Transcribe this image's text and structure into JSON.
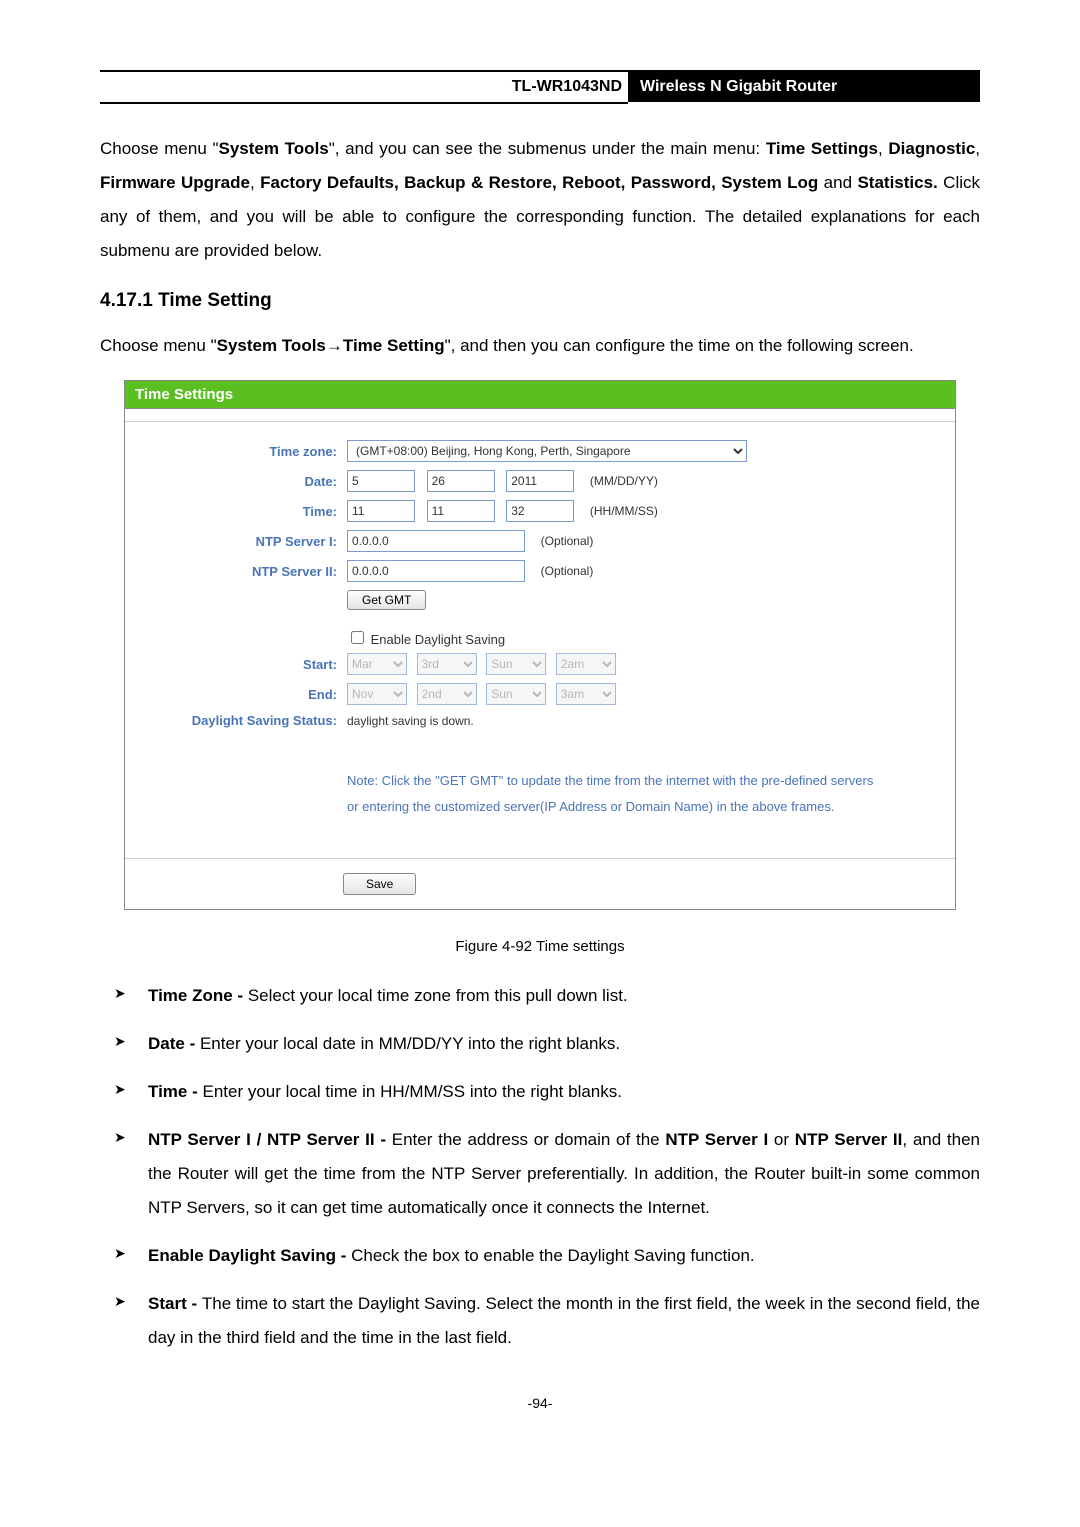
{
  "header": {
    "model": "TL-WR1043ND",
    "title": "Wireless N Gigabit Router"
  },
  "intro_paragraph_parts": {
    "p1a": "Choose menu \"",
    "p1b": "\", and you can see the submenus under the main menu: ",
    "p1c": ", ",
    "p1d": ", ",
    "p1e": ", ",
    "p1f": " and ",
    "p1g": " Click any of them, and you will be able to configure the corresponding function. The detailed explanations for each submenu are provided below.",
    "bold": {
      "system_tools": "System Tools",
      "time_settings": "Time Settings",
      "diagnostic": "Diagnostic",
      "firmware": "Firmware Upgrade",
      "factory": "Factory Defaults, Backup & Restore, Reboot, Password, System Log",
      "statistics": "Statistics."
    }
  },
  "section_heading": "4.17.1  Time Setting",
  "setting_paragraph": {
    "a": "Choose menu \"",
    "b": "\", and then you can configure the time on the following screen.",
    "bold": "System Tools→Time Setting"
  },
  "panel": {
    "title": "Time Settings",
    "labels": {
      "timezone": "Time zone:",
      "date": "Date:",
      "time": "Time:",
      "ntp1": "NTP Server I:",
      "ntp2": "NTP Server II:",
      "start": "Start:",
      "end": "End:",
      "dss": "Daylight Saving Status:"
    },
    "values": {
      "tz_option": "(GMT+08:00) Beijing, Hong Kong, Perth, Singapore",
      "date_m": "5",
      "date_d": "26",
      "date_y": "2011",
      "date_hint": "(MM/DD/YY)",
      "time_h": "11",
      "time_m": "11",
      "time_s": "32",
      "time_hint": "(HH/MM/SS)",
      "ntp1": "0.0.0.0",
      "ntp1_hint": "(Optional)",
      "ntp2": "0.0.0.0",
      "ntp2_hint": "(Optional)",
      "get_gmt": "Get GMT",
      "enable_dls": "Enable Daylight Saving",
      "start_mon": "Mar",
      "start_wk": "3rd",
      "start_day": "Sun",
      "start_hr": "2am",
      "end_mon": "Nov",
      "end_wk": "2nd",
      "end_day": "Sun",
      "end_hr": "3am",
      "dss_text": "daylight saving is down.",
      "note1": "Note: Click the \"GET GMT\" to update the time from the internet with the pre-defined servers",
      "note2": "or entering the customized server(IP Address or Domain Name) in the above frames.",
      "save": "Save"
    }
  },
  "figure_caption": "Figure 4-92    Time settings",
  "bullets": {
    "b1": {
      "bold": "Time Zone - ",
      "text": "Select your local time zone from this pull down list."
    },
    "b2": {
      "bold": "Date - ",
      "text": "Enter your local date in MM/DD/YY into the right blanks."
    },
    "b3": {
      "bold": "Time - ",
      "text": "Enter your local time in HH/MM/SS into the right blanks."
    },
    "b4": {
      "bold1": "NTP Server I / NTP Server II - ",
      "text1": "Enter the address or domain of the ",
      "bold2": "NTP Server I",
      "text2": " or ",
      "bold3": "NTP Server II",
      "text3": ", and then the Router will get the time from the NTP Server preferentially. In addition, the Router built-in some common NTP Servers, so it can get time automatically once it connects the Internet."
    },
    "b5": {
      "bold": "Enable Daylight Saving - ",
      "text": "Check the box to enable the Daylight Saving function."
    },
    "b6": {
      "bold": "Start - ",
      "text": "The time to start the Daylight Saving. Select the month in the first field, the week in the second field, the day in the third field and the time in the last field."
    }
  },
  "page_number": "-94-"
}
